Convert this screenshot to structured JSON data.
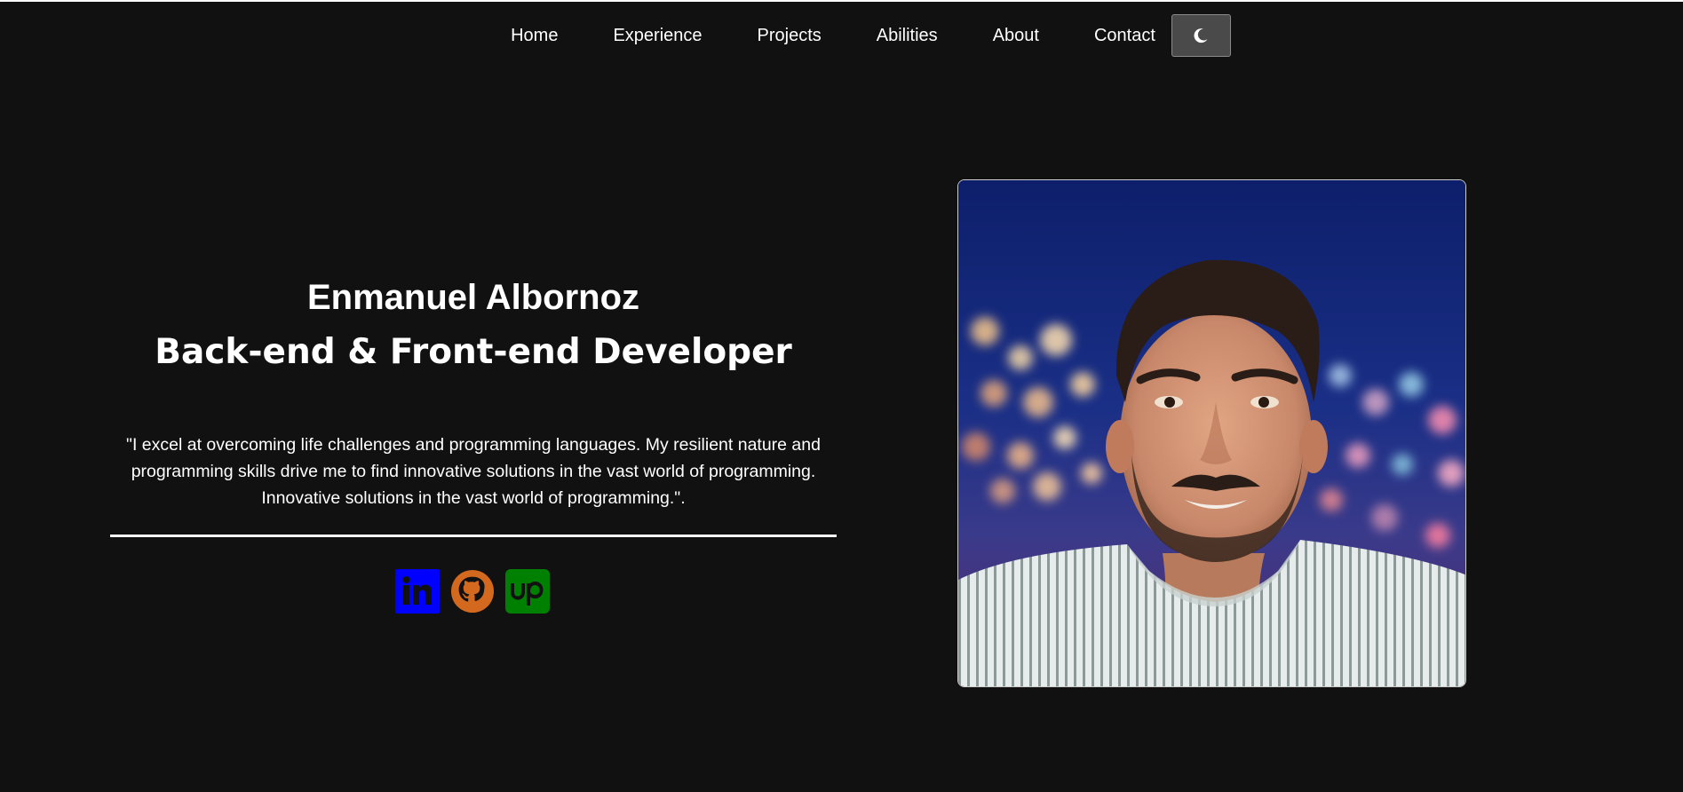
{
  "nav": {
    "items": [
      {
        "label": "Home"
      },
      {
        "label": "Experience"
      },
      {
        "label": "Projects"
      },
      {
        "label": "Abilities"
      },
      {
        "label": "About"
      },
      {
        "label": "Contact"
      }
    ],
    "theme_toggle_icon": "moon-icon"
  },
  "hero": {
    "name": "Enmanuel Albornoz",
    "role": "Back-end & Front-end Developer",
    "quote": "\"I excel at overcoming life challenges and programming languages. My resilient nature and programming skills drive me to find innovative solutions in the vast world of programming. Innovative solutions in the vast world of programming.\"."
  },
  "social": [
    {
      "icon": "linkedin-icon",
      "color": "#0000ff"
    },
    {
      "icon": "github-icon",
      "color": "#d2691e"
    },
    {
      "icon": "upwork-icon",
      "color": "#008000"
    }
  ],
  "colors": {
    "background": "#111111",
    "text": "#ffffff",
    "toggle_bg": "#4a4a4a"
  }
}
